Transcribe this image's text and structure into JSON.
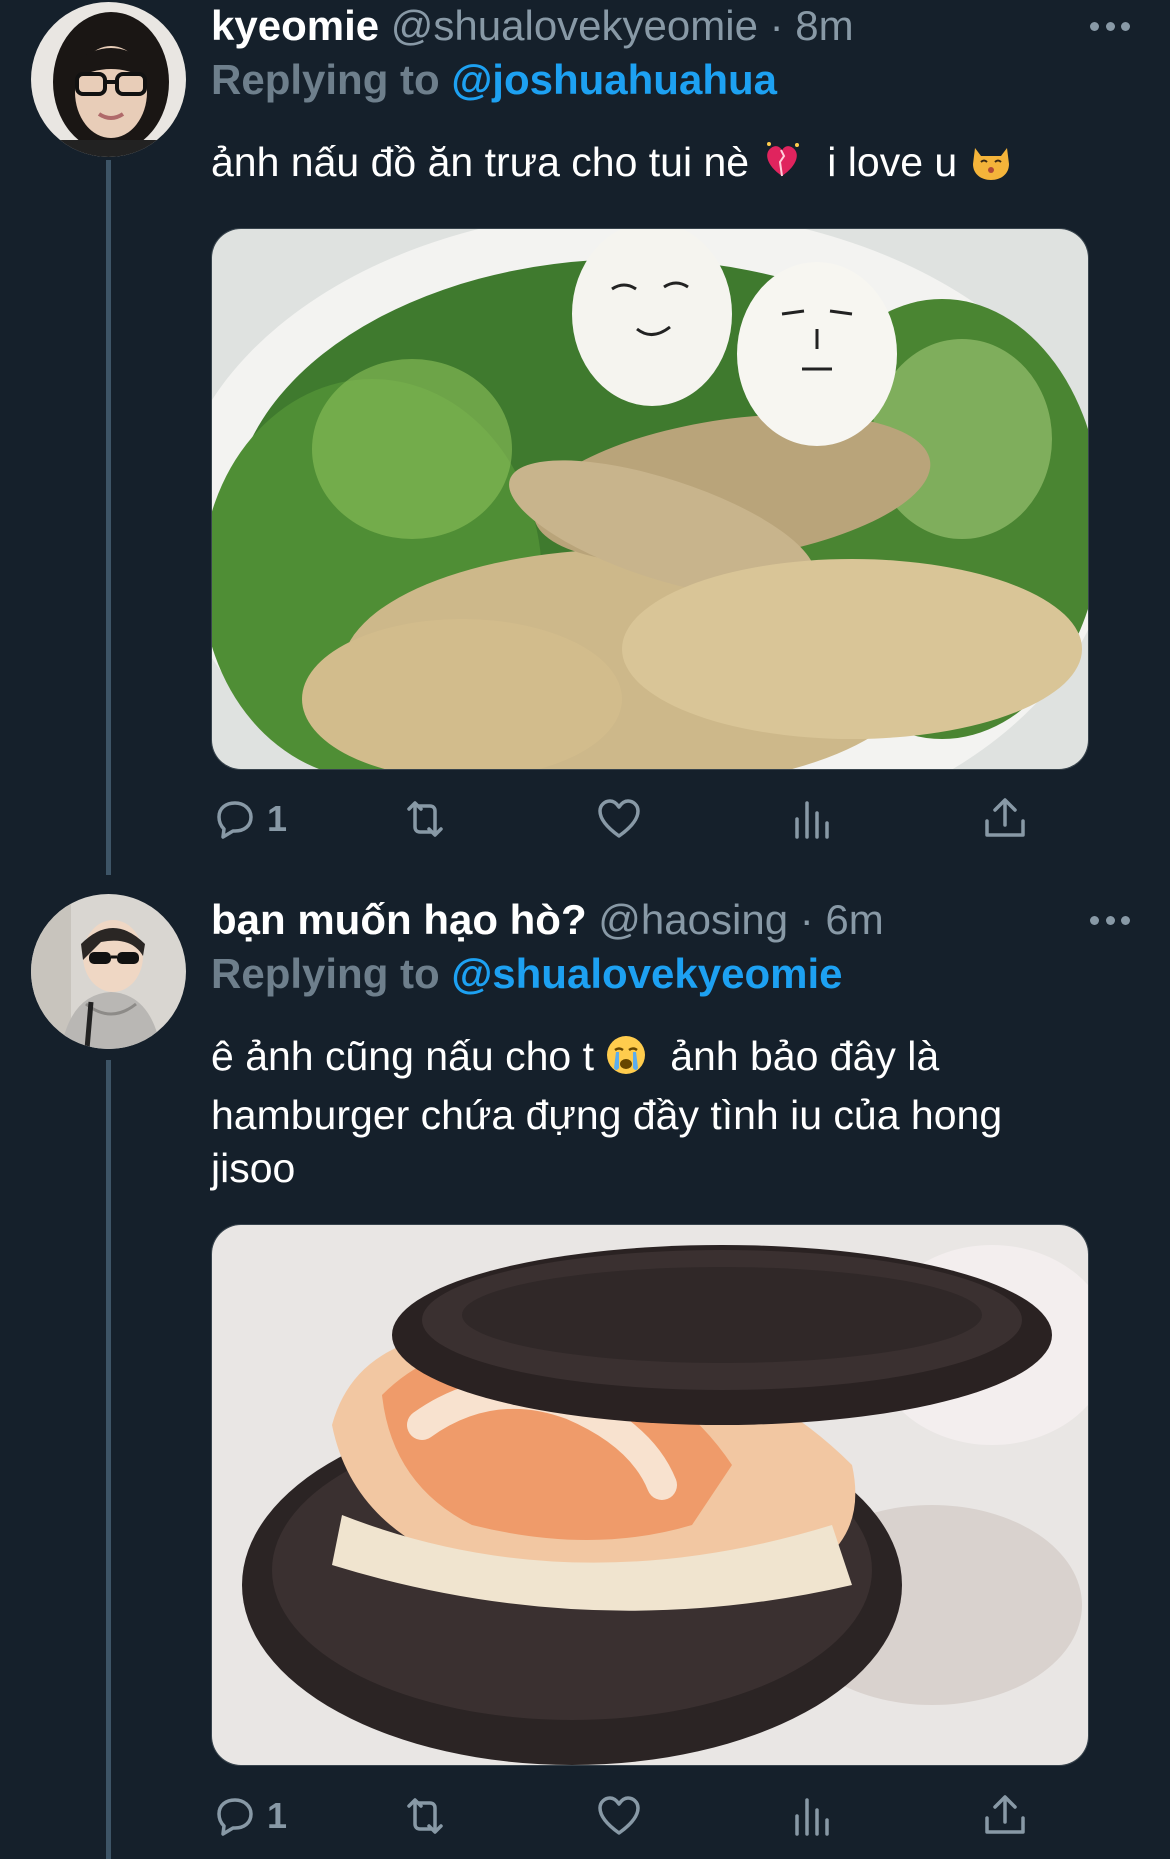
{
  "tweets": [
    {
      "name": "kyeomie",
      "handle": "@shualovekyeomie",
      "separator": "·",
      "time": "8m",
      "replying_label": "Replying to",
      "replying_to": "@joshuahuahua",
      "text_part1": "ảnh nấu đồ ăn trưa cho tui nè",
      "emoji1": "heart-with-sparkles",
      "text_part2": "i love u",
      "emoji2": "kissing-cat",
      "reply_count": "1",
      "media_description": "plate of chicken wings with egg faces on lettuce"
    },
    {
      "name": "bạn muốn hạo hò?",
      "handle": "@haosing",
      "separator": "·",
      "time": "6m",
      "replying_label": "Replying to",
      "replying_to": "@shualovekyeomie",
      "text_line1_part1": "ê ảnh cũng nấu cho t",
      "emoji1": "crying-face",
      "text_line1_part2": "ảnh bảo đây là",
      "text_line2": "hamburger chứa đựng đầy tình iu của hong",
      "text_line3": "jisoo",
      "reply_count": "1",
      "media_description": "shrimp sandwiched between two chocolate cookies"
    }
  ],
  "colors": {
    "background": "#15202b",
    "text_secondary": "#8899a6",
    "link": "#1da1f2",
    "thread_line": "#3d5466"
  }
}
